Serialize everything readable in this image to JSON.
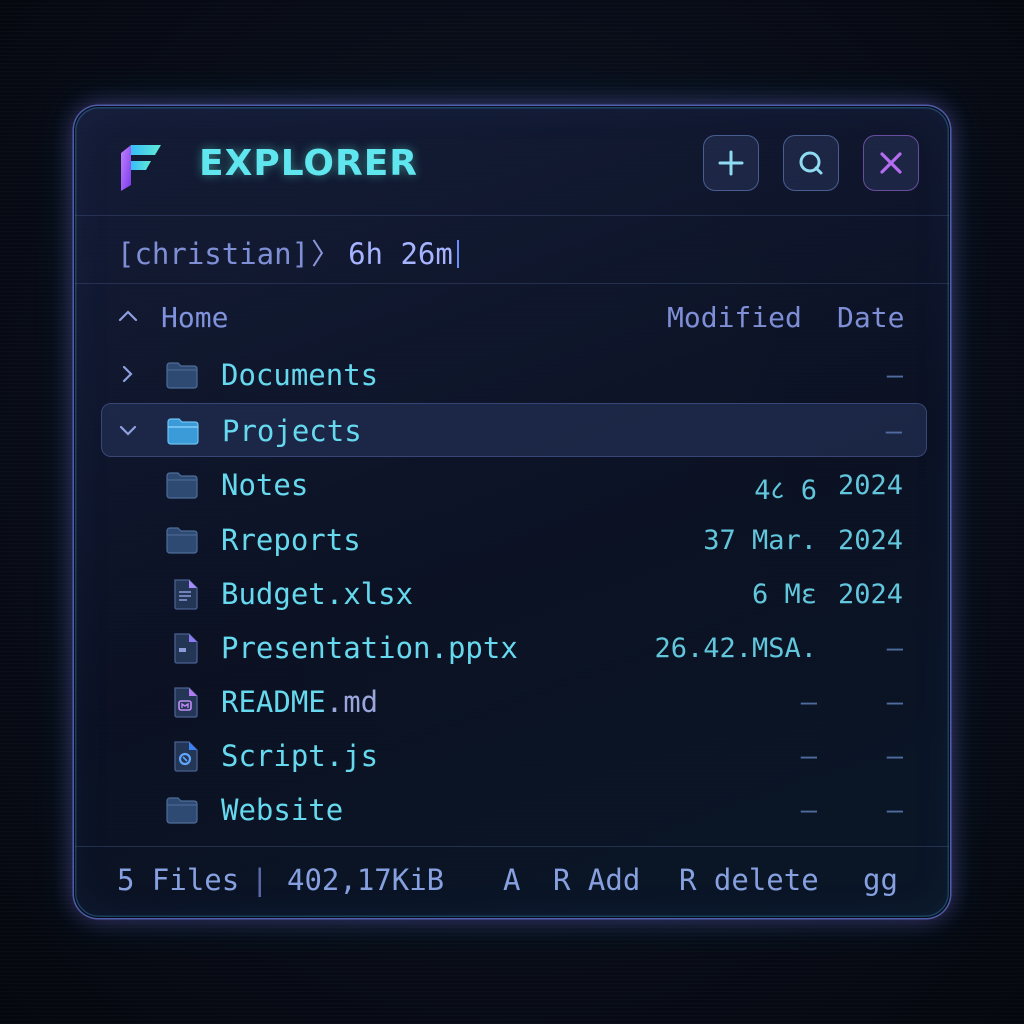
{
  "window": {
    "title": "EXPLORER",
    "buttons": {
      "add": "add-icon",
      "search": "search-icon",
      "close": "close-icon"
    }
  },
  "prompt": {
    "user": "[christian]",
    "chevron": "〉",
    "time": "6h 26m"
  },
  "columns": {
    "home": "Home",
    "modified": "Modified",
    "date": "Date"
  },
  "rows": [
    {
      "name": "Documents",
      "ext": "",
      "modified": "",
      "date": "—",
      "type": "folder",
      "chevron": "right",
      "selected": false
    },
    {
      "name": "Projects",
      "ext": "",
      "modified": "",
      "date": "—",
      "type": "folder-open",
      "chevron": "down",
      "selected": true
    },
    {
      "name": "Notes",
      "ext": "",
      "modified": "4८ 6",
      "date": "2024",
      "type": "folder",
      "chevron": "",
      "selected": false
    },
    {
      "name": "Rreports",
      "ext": "",
      "modified": "37 Mar.",
      "date": "2024",
      "type": "folder",
      "chevron": "",
      "selected": false
    },
    {
      "name": "Budget.xlsx",
      "ext": "",
      "modified": "6 Mε",
      "date": "2024",
      "type": "sheet",
      "chevron": "",
      "selected": false
    },
    {
      "name": "Presentation.pptx",
      "ext": "",
      "modified": "26.42.MSA.",
      "date": "—",
      "type": "slides",
      "chevron": "",
      "selected": false
    },
    {
      "name": "README",
      "ext": ".md",
      "modified": "—",
      "date": "—",
      "type": "markdown",
      "chevron": "",
      "selected": false
    },
    {
      "name": "Script.js",
      "ext": "",
      "modified": "—",
      "date": "—",
      "type": "script",
      "chevron": "",
      "selected": false
    },
    {
      "name": "Website",
      "ext": "",
      "modified": "—",
      "date": "—",
      "type": "folder",
      "chevron": "",
      "selected": false
    }
  ],
  "footer": {
    "files": "5 Files",
    "separator": "|",
    "size": "402,17KiB",
    "a": "A",
    "radd": "R Add",
    "rdelete": "R delete",
    "gg": "gg"
  },
  "colors": {
    "accent_cyan": "#5fe6ee",
    "accent_purple": "#a855f7",
    "text_blue": "#7f8fd6"
  }
}
